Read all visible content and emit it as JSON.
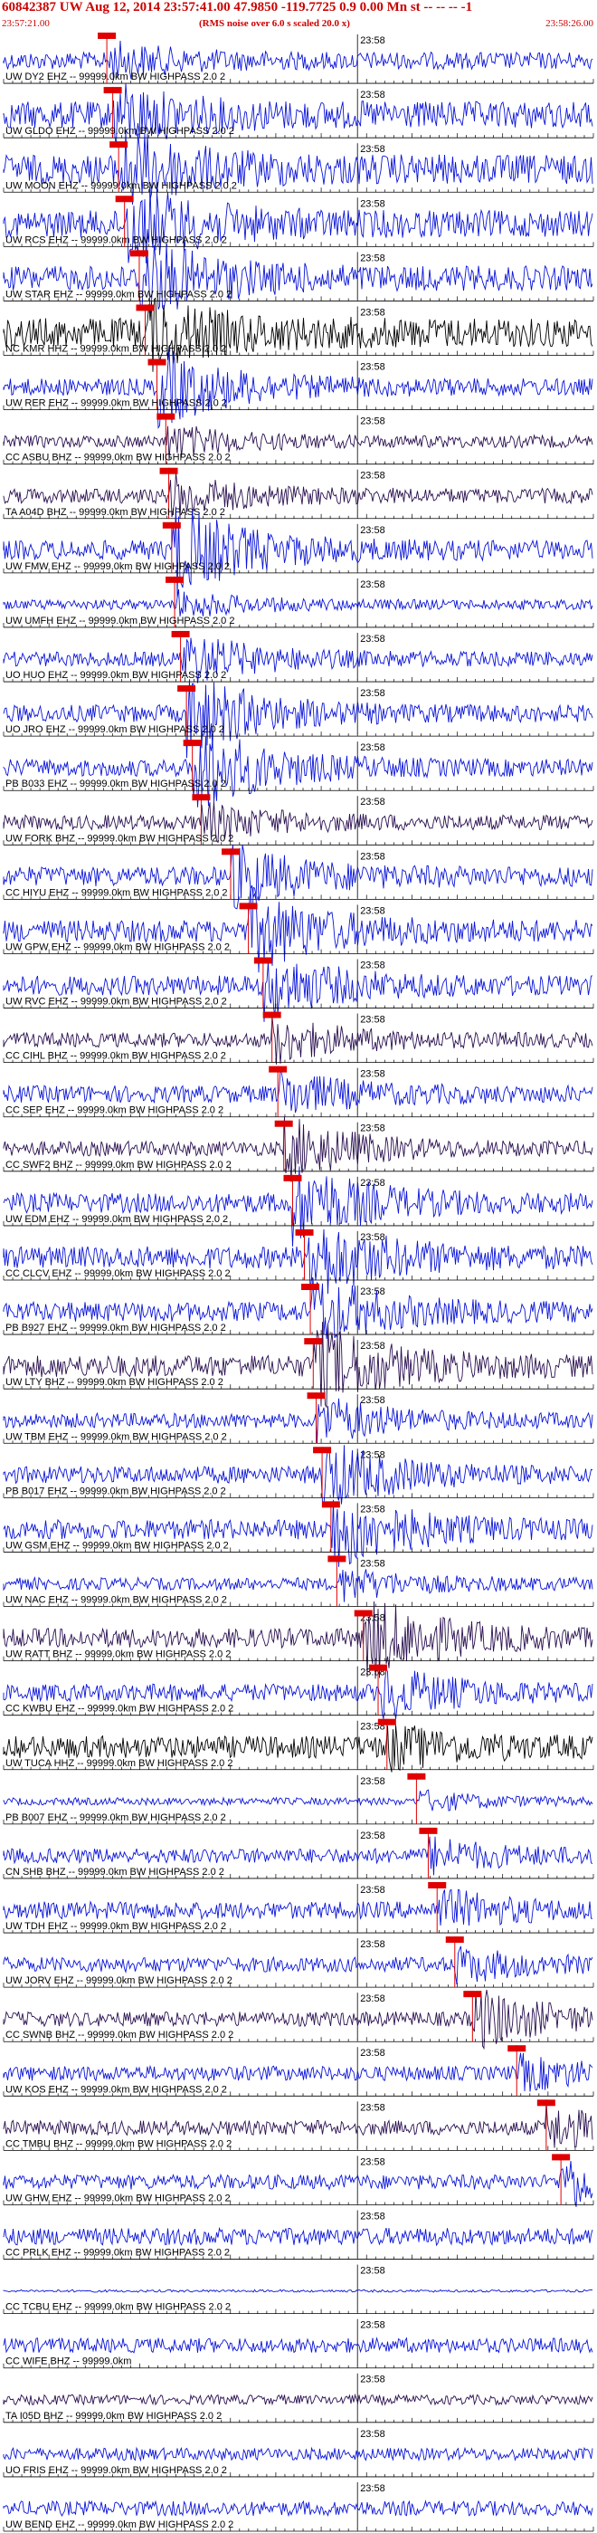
{
  "header": {
    "title": "60842387 UW Aug 12, 2014 23:57:41.00   47.9850 -119.7725  0.9 0.00 Mn st -- -- --  -1",
    "start_time": "23:57:21.00",
    "noise_note": "(RMS noise over 6.0 s scaled 20.0 x)",
    "end_time": "23:58:26.00"
  },
  "time_tick_label": "23:58",
  "colors": {
    "blue": "#0a14d8",
    "dark": "#2a1050",
    "black": "#000000",
    "pick": "#e00000",
    "grid": "#000000"
  },
  "traces": [
    {
      "label": "UW DY2 EHZ -- 99999.0km BW  HIGHPASS  2.0  2",
      "color": "blue",
      "amp": 0.35,
      "pick": 0.175,
      "burst": 0.6
    },
    {
      "label": "UW GLDO EHZ -- 99999.0km BW  HIGHPASS  2.0  2",
      "color": "blue",
      "amp": 0.55,
      "pick": 0.185,
      "burst": 1.0
    },
    {
      "label": "UW MOON EHZ -- 99999.0km BW  HIGHPASS  2.0  2",
      "color": "blue",
      "amp": 0.6,
      "pick": 0.195,
      "burst": 1.4
    },
    {
      "label": "UW RCS EHZ -- 99999.0km BW  HIGHPASS  2.0  2",
      "color": "blue",
      "amp": 0.55,
      "pick": 0.205,
      "burst": 1.5
    },
    {
      "label": "UW STAR EHZ -- 99999.0km BW  HIGHPASS  2.0  2",
      "color": "blue",
      "amp": 0.5,
      "pick": 0.23,
      "burst": 1.5
    },
    {
      "label": "NC KMR HHZ -- 99999.0km BW  HIGHPASS  2.0  2",
      "color": "black",
      "amp": 0.6,
      "pick": 0.24,
      "burst": 1.2
    },
    {
      "label": "UW RER EHZ -- 99999.0km BW  HIGHPASS  2.0  2",
      "color": "blue",
      "amp": 0.35,
      "pick": 0.26,
      "burst": 1.5
    },
    {
      "label": "CC ASBU BHZ -- 99999.0km BW  HIGHPASS  2.0  2",
      "color": "dark",
      "amp": 0.25,
      "pick": 0.275,
      "burst": 0.6
    },
    {
      "label": "TA A04D BHZ -- 99999.0km BW  HIGHPASS  2.0  2",
      "color": "dark",
      "amp": 0.3,
      "pick": 0.28,
      "burst": 0.8
    },
    {
      "label": "UW FMW EHZ -- 99999.0km BW  HIGHPASS  2.0  2",
      "color": "blue",
      "amp": 0.4,
      "pick": 0.285,
      "burst": 1.8
    },
    {
      "label": "UW UMFH EHZ -- 99999.0km BW  HIGHPASS  2.0  2",
      "color": "blue",
      "amp": 0.2,
      "pick": 0.29,
      "burst": 0.5
    },
    {
      "label": "UO HUO EHZ -- 99999.0km BW  HIGHPASS  2.0  2",
      "color": "blue",
      "amp": 0.3,
      "pick": 0.3,
      "burst": 1.0
    },
    {
      "label": "UO JRO EHZ -- 99999.0km BW  HIGHPASS  2.0  2",
      "color": "blue",
      "amp": 0.35,
      "pick": 0.31,
      "burst": 1.6
    },
    {
      "label": "PB B033 EHZ -- 99999.0km BW  HIGHPASS  2.0  2",
      "color": "blue",
      "amp": 0.35,
      "pick": 0.32,
      "burst": 1.8
    },
    {
      "label": "UW FORK BHZ -- 99999.0km BW  HIGHPASS  2.0  2",
      "color": "dark",
      "amp": 0.3,
      "pick": 0.335,
      "burst": 0.7
    },
    {
      "label": "CC HIYU EHZ -- 99999.0km BW  HIGHPASS  2.0  2",
      "color": "blue",
      "amp": 0.4,
      "pick": 0.385,
      "burst": 1.1
    },
    {
      "label": "UW GPW EHZ -- 99999.0km BW  HIGHPASS  2.0  2",
      "color": "blue",
      "amp": 0.45,
      "pick": 0.415,
      "burst": 1.5
    },
    {
      "label": "UW RVC EHZ -- 99999.0km BW  HIGHPASS  2.0  2",
      "color": "blue",
      "amp": 0.4,
      "pick": 0.44,
      "burst": 1.2
    },
    {
      "label": "CC CIHL BHZ -- 99999.0km BW  HIGHPASS  2.0  2",
      "color": "dark",
      "amp": 0.3,
      "pick": 0.455,
      "burst": 0.8
    },
    {
      "label": "CC SEP EHZ -- 99999.0km BW  HIGHPASS  2.0  2",
      "color": "blue",
      "amp": 0.35,
      "pick": 0.465,
      "burst": 0.8
    },
    {
      "label": "CC SWF2 BHZ -- 99999.0km BW  HIGHPASS  2.0  2",
      "color": "dark",
      "amp": 0.3,
      "pick": 0.475,
      "burst": 1.2
    },
    {
      "label": "UW EDM EHZ -- 99999.0km BW  HIGHPASS  2.0  2",
      "color": "blue",
      "amp": 0.4,
      "pick": 0.49,
      "burst": 1.5
    },
    {
      "label": "CC CLCV EHZ -- 99999.0km BW  HIGHPASS  2.0  2",
      "color": "blue",
      "amp": 0.45,
      "pick": 0.51,
      "burst": 1.6
    },
    {
      "label": "PB B927 EHZ -- 99999.0km BW  HIGHPASS  2.0  2",
      "color": "blue",
      "amp": 0.4,
      "pick": 0.52,
      "burst": 1.3
    },
    {
      "label": "UW LTY BHZ -- 99999.0km BW  HIGHPASS  2.0  2",
      "color": "dark",
      "amp": 0.45,
      "pick": 0.525,
      "burst": 1.6
    },
    {
      "label": "UW TBM EHZ -- 99999.0km BW  HIGHPASS  2.0  2",
      "color": "blue",
      "amp": 0.3,
      "pick": 0.53,
      "burst": 0.9
    },
    {
      "label": "PB B017 EHZ -- 99999.0km BW  HIGHPASS  2.0  2",
      "color": "blue",
      "amp": 0.35,
      "pick": 0.54,
      "burst": 1.3
    },
    {
      "label": "UW GSM EHZ -- 99999.0km BW  HIGHPASS  2.0  2",
      "color": "blue",
      "amp": 0.4,
      "pick": 0.555,
      "burst": 1.5
    },
    {
      "label": "UW NAC EHZ -- 99999.0km BW  HIGHPASS  2.0  2",
      "color": "blue",
      "amp": 0.25,
      "pick": 0.565,
      "burst": 0.6
    },
    {
      "label": "UW RATT BHZ -- 99999.0km BW  HIGHPASS  2.0  2",
      "color": "dark",
      "amp": 0.4,
      "pick": 0.61,
      "burst": 1.6
    },
    {
      "label": "CC KWBU EHZ -- 99999.0km BW  HIGHPASS  2.0  2",
      "color": "blue",
      "amp": 0.35,
      "pick": 0.635,
      "burst": 1.0
    },
    {
      "label": "UW TUCA HHZ -- 99999.0km BW  HIGHPASS  2.0  2",
      "color": "black",
      "amp": 0.45,
      "pick": 0.65,
      "burst": 0.7
    },
    {
      "label": "PB B007 EHZ -- 99999.0km BW  HIGHPASS  2.0  2",
      "color": "blue",
      "amp": 0.15,
      "pick": 0.7,
      "burst": 0.4
    },
    {
      "label": "CN SHB BHZ -- 99999.0km BW  HIGHPASS  2.0  2",
      "color": "blue",
      "amp": 0.3,
      "pick": 0.72,
      "burst": 0.6
    },
    {
      "label": "UW TDH EHZ -- 99999.0km BW  HIGHPASS  2.0  2",
      "color": "blue",
      "amp": 0.35,
      "pick": 0.735,
      "burst": 0.7
    },
    {
      "label": "UW JORV EHZ -- 99999.0km BW  HIGHPASS  2.0  2",
      "color": "blue",
      "amp": 0.3,
      "pick": 0.765,
      "burst": 0.6
    },
    {
      "label": "CC SWNB BHZ -- 99999.0km BW  HIGHPASS  2.0  2",
      "color": "dark",
      "amp": 0.3,
      "pick": 0.795,
      "burst": 1.2
    },
    {
      "label": "UW KOS EHZ -- 99999.0km BW  HIGHPASS  2.0  2",
      "color": "blue",
      "amp": 0.3,
      "pick": 0.87,
      "burst": 0.6
    },
    {
      "label": "CC TMBU BHZ -- 99999.0km BW  HIGHPASS  2.0  2",
      "color": "dark",
      "amp": 0.3,
      "pick": 0.92,
      "burst": 0.8
    },
    {
      "label": "UW GHW EHZ -- 99999.0km BW  HIGHPASS  2.0  2",
      "color": "blue",
      "amp": 0.3,
      "pick": 0.945,
      "burst": 1.0
    },
    {
      "label": "CC PRLK EHZ -- 99999.0km BW  HIGHPASS  2.0  2",
      "color": "blue",
      "amp": 0.35,
      "pick": null,
      "burst": 0
    },
    {
      "label": "CC TCBU EHZ -- 99999.0km BW  HIGHPASS  2.0  2",
      "color": "blue",
      "amp": 0.05,
      "pick": null,
      "burst": 0
    },
    {
      "label": "CC WIFE BHZ -- 99999.0km",
      "color": "blue",
      "amp": 0.3,
      "pick": null,
      "burst": 0
    },
    {
      "label": "TA I05D BHZ -- 99999.0km BW  HIGHPASS  2.0  2",
      "color": "dark",
      "amp": 0.2,
      "pick": null,
      "burst": 0
    },
    {
      "label": "UO FRIS EHZ -- 99999.0km BW  HIGHPASS  2.0  2",
      "color": "blue",
      "amp": 0.25,
      "pick": null,
      "burst": 0
    },
    {
      "label": "UW BEND EHZ -- 99999.0km BW  HIGHPASS  2.0  2",
      "color": "blue",
      "amp": 0.3,
      "pick": null,
      "burst": 0
    }
  ]
}
